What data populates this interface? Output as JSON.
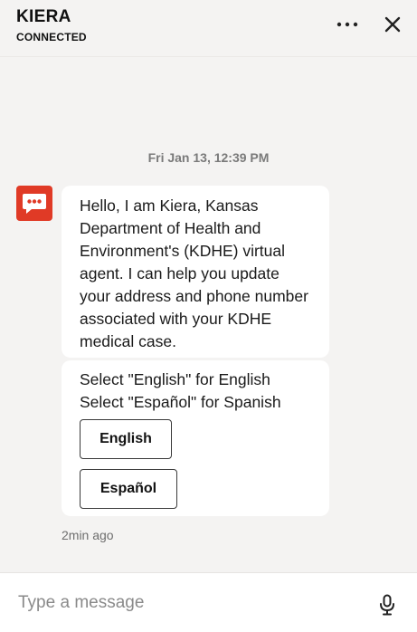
{
  "header": {
    "agent_name": "KIERA",
    "status": "CONNECTED",
    "menu_icon": "more-horizontal-icon",
    "close_icon": "close-icon"
  },
  "conversation": {
    "timestamp": "Fri Jan 13, 12:39 PM",
    "bot_avatar_icon": "chat-bubble-icon",
    "bot_avatar_color": "#e03a26",
    "greeting": "Hello, I am Kiera, Kansas Department of Health and Environment's (KDHE) virtual agent. I can help you update your address and phone number associated with your KDHE medical case.",
    "language_prompt": [
      "Select \"English\" for English",
      "Select \"Español\" for Spanish"
    ],
    "options": [
      {
        "label": "English"
      },
      {
        "label": "Español"
      }
    ],
    "message_age": "2min ago"
  },
  "composer": {
    "placeholder": "Type a message",
    "mic_icon": "microphone-icon"
  }
}
